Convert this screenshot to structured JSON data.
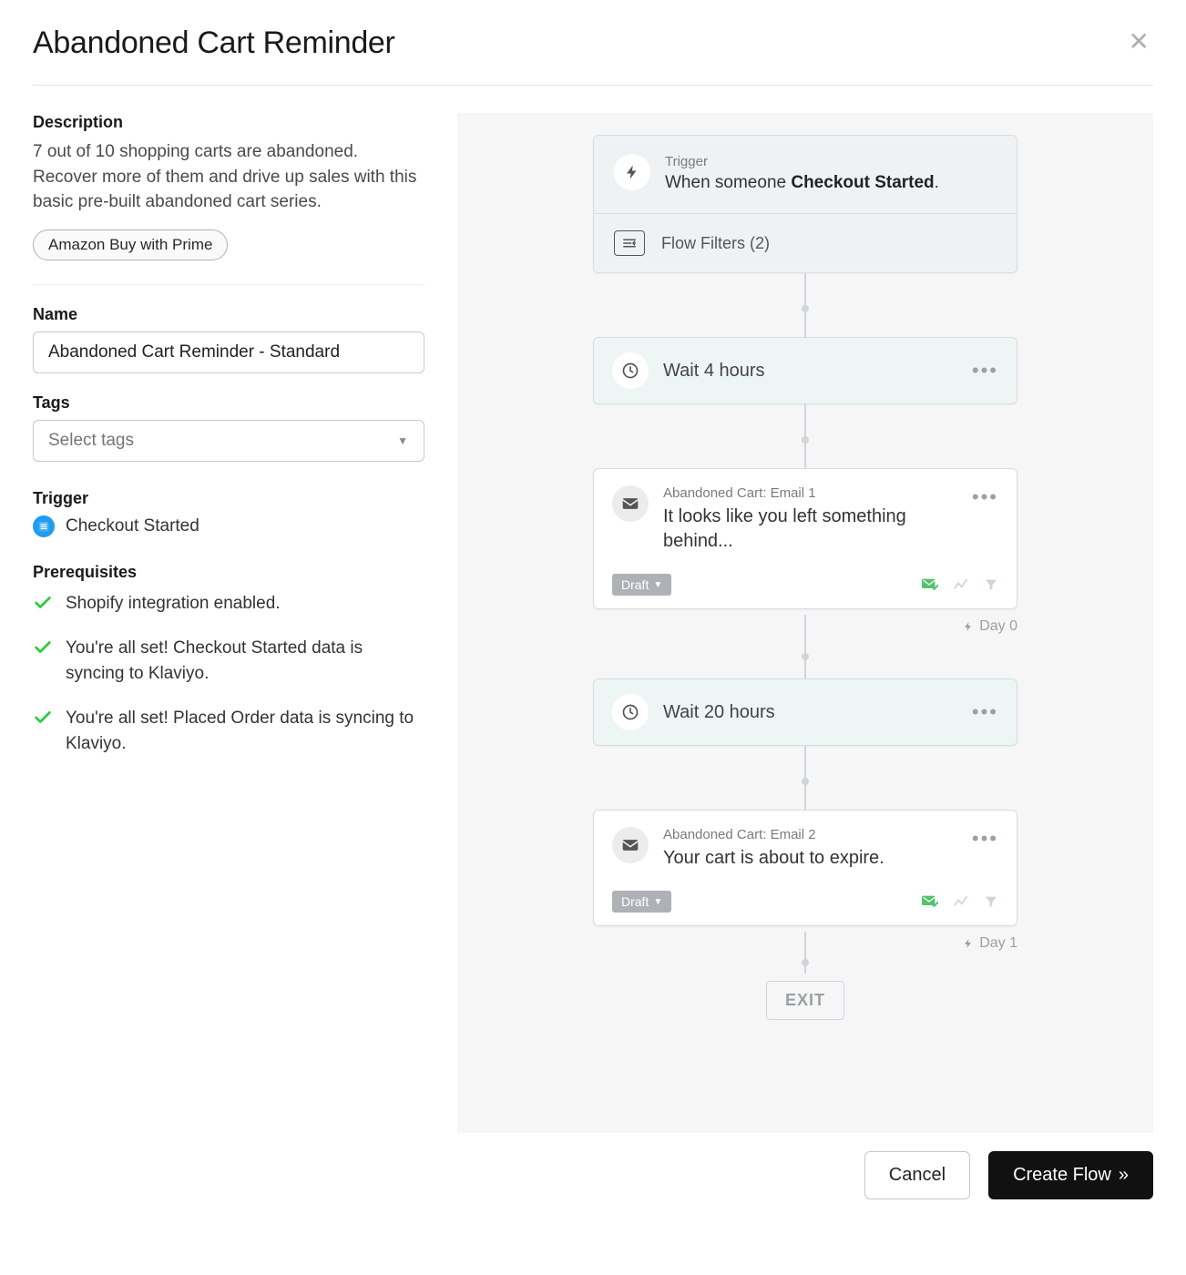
{
  "header": {
    "title": "Abandoned Cart Reminder"
  },
  "description": {
    "label": "Description",
    "text": "7 out of 10 shopping carts are abandoned. Recover more of them and drive up sales with this basic pre-built abandoned cart series.",
    "chip": "Amazon Buy with Prime"
  },
  "name": {
    "label": "Name",
    "value": "Abandoned Cart Reminder - Standard"
  },
  "tags": {
    "label": "Tags",
    "placeholder": "Select tags"
  },
  "trigger": {
    "label": "Trigger",
    "value": "Checkout Started"
  },
  "prereq": {
    "label": "Prerequisites",
    "items": [
      "Shopify integration enabled.",
      "You're all set! Checkout Started data is syncing to Klaviyo.",
      "You're all set! Placed Order data is syncing to Klaviyo."
    ]
  },
  "flow": {
    "trigger_card": {
      "label": "Trigger",
      "prefix": "When someone ",
      "event": "Checkout Started",
      "suffix": ".",
      "filters_label": "Flow Filters (2)"
    },
    "wait1": "Wait 4 hours",
    "email1": {
      "name": "Abandoned Cart: Email 1",
      "subject": "It looks like you left something behind...",
      "status": "Draft"
    },
    "day0": "Day 0",
    "wait2": "Wait 20 hours",
    "email2": {
      "name": "Abandoned Cart: Email 2",
      "subject": "Your cart is about to expire.",
      "status": "Draft"
    },
    "day1": "Day 1",
    "exit": "EXIT"
  },
  "footer": {
    "cancel": "Cancel",
    "create": "Create Flow"
  }
}
